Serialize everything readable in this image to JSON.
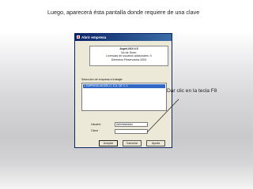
{
  "slide": {
    "caption": "Luego, aparecerá ésta pantalla donde requiere de una clave",
    "callout": "Dar clic en la tecla F8"
  },
  "dialog": {
    "title": "Abrir empresa",
    "info": {
      "product": "Aspel-NOI 4.5",
      "serial": "No.de Serie:",
      "licenses": "Licencias de usuarios adicionales: 0",
      "copyright": "Derechos Reservados 2004"
    },
    "company_list_label": "Selección de empresa a trabajar",
    "companies": [
      "1 EMPRESA MODELO, S.A. DE C.V."
    ],
    "user_label": "Usuario",
    "user_value": "Administrador",
    "password_label": "Clave",
    "password_value": "",
    "buttons": {
      "accept": "Aceptar",
      "cancel": "Cancelar",
      "help": "Ayuda"
    }
  }
}
